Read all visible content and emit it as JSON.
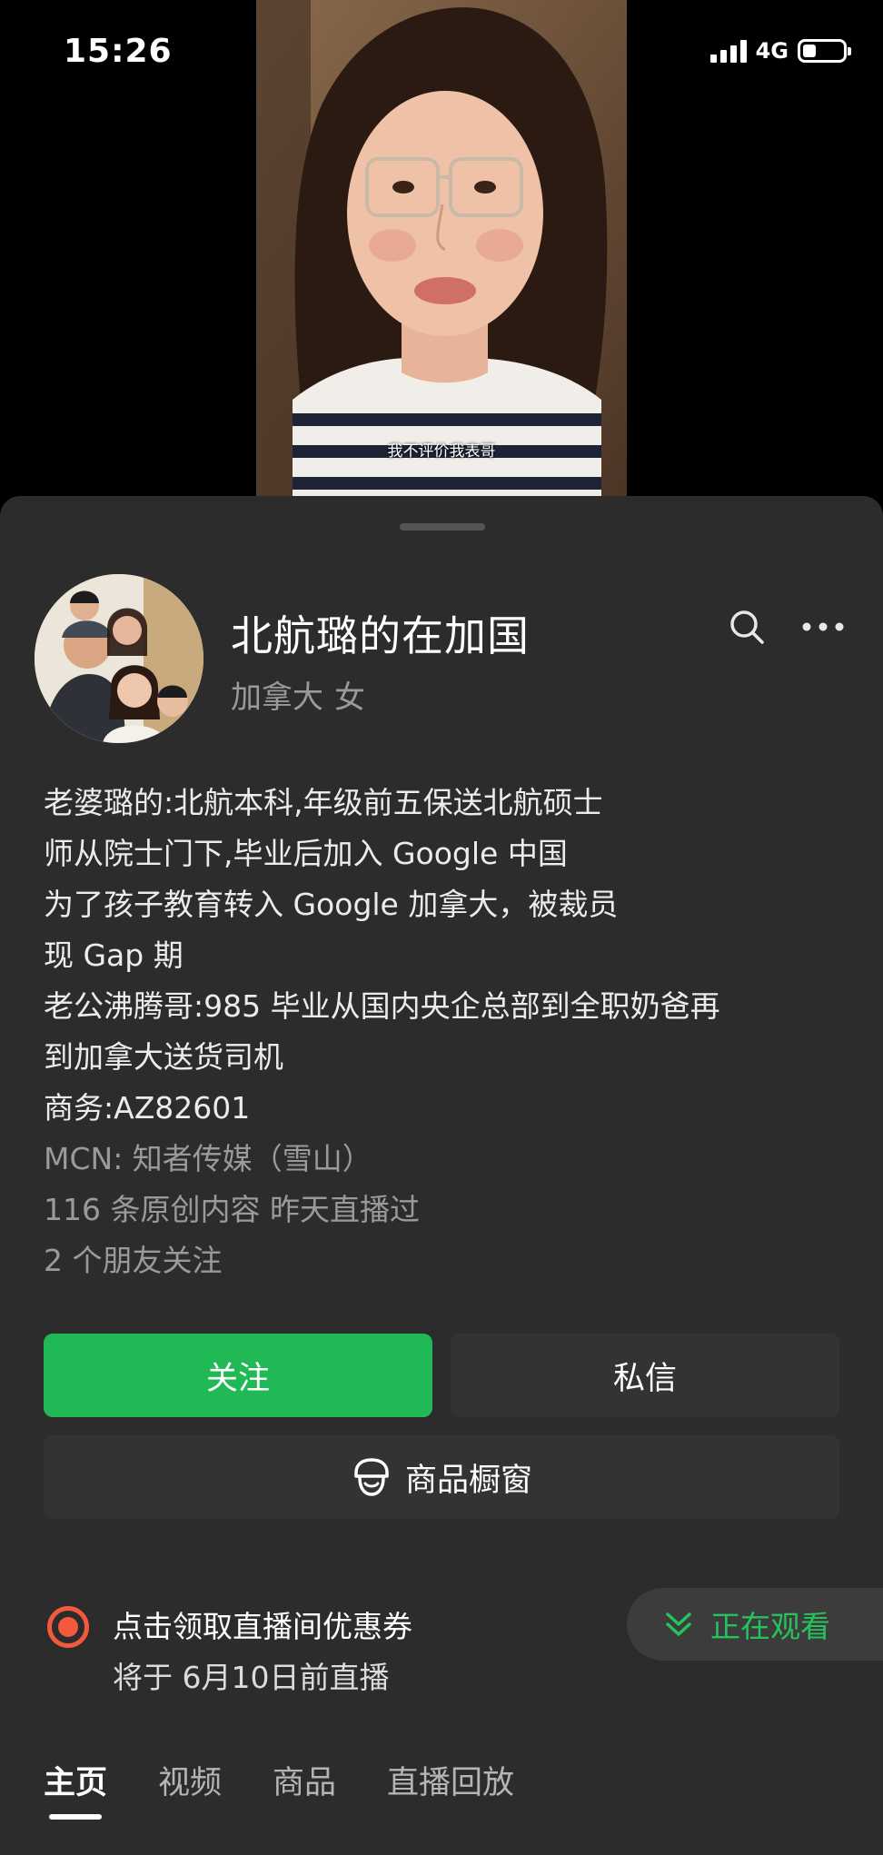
{
  "status_bar": {
    "time": "15:26",
    "network": "4G"
  },
  "video": {
    "subtitle": "我不评价我表哥"
  },
  "profile": {
    "name": "北航璐的在加国",
    "location": "加拿大",
    "gender": "女",
    "bio": [
      "老婆璐的:北航本科,年级前五保送北航硕士",
      "师从院士门下,毕业后加入 Google 中国",
      "为了孩子教育转入 Google 加拿大，被裁员",
      "现 Gap 期",
      "老公沸腾哥:985 毕业从国内央企总部到全职奶爸再",
      "到加拿大送货司机",
      "商务:AZ82601"
    ],
    "mcn": "MCN: 知者传媒（雪山）",
    "stats": "116 条原创内容  昨天直播过",
    "friends": "2 个朋友关注"
  },
  "actions": {
    "follow": "关注",
    "message": "私信",
    "shop": "商品橱窗"
  },
  "live": {
    "title": "点击领取直播间优惠券",
    "subtitle": "将于 6月10日前直播"
  },
  "watching": {
    "label": "正在观看"
  },
  "tabs": [
    "主页",
    "视频",
    "商品",
    "直播回放"
  ],
  "colors": {
    "accent_green": "#20b955",
    "live_red": "#f3593f",
    "sheet_bg": "#2c2c2c"
  },
  "icons": {
    "search": "search-icon",
    "more": "more-icon",
    "shop": "shop-icon",
    "live": "live-dot-icon",
    "watching": "chevron-down-double-icon"
  }
}
